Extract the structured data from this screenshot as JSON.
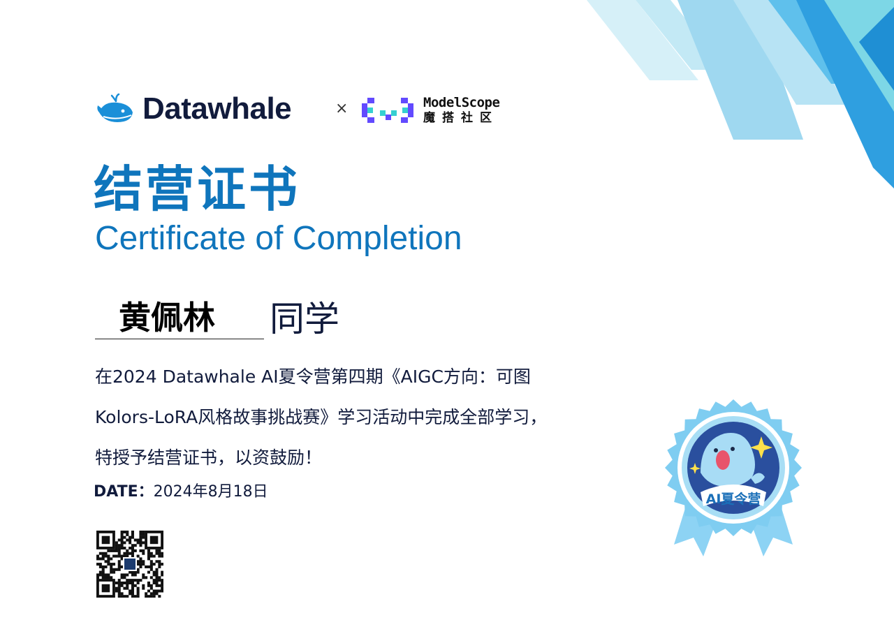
{
  "header": {
    "datawhale_name": "Datawhale",
    "times_symbol": "×",
    "modelscope_en": "ModelScope",
    "modelscope_cn": "魔搭社区"
  },
  "title": {
    "cn": "结营证书",
    "en": "Certificate of Completion"
  },
  "recipient": {
    "name": "黄佩林",
    "suffix": "同学"
  },
  "body": {
    "line1": "在2024 Datawhale AI夏令营第四期《AIGC方向：可图",
    "line2": "Kolors-LoRA风格故事挑战赛》学习活动中完成全部学习，",
    "line3": "特授予结营证书，以资鼓励！"
  },
  "date": {
    "label": "DATE：",
    "value": "2024年8月18日"
  },
  "badge": {
    "text": "AI夏令营"
  },
  "colors": {
    "brand_blue": "#0f75bc",
    "navy": "#111b3c",
    "modelscope_purple": "#624aff",
    "modelscope_teal": "#36cfd1"
  }
}
